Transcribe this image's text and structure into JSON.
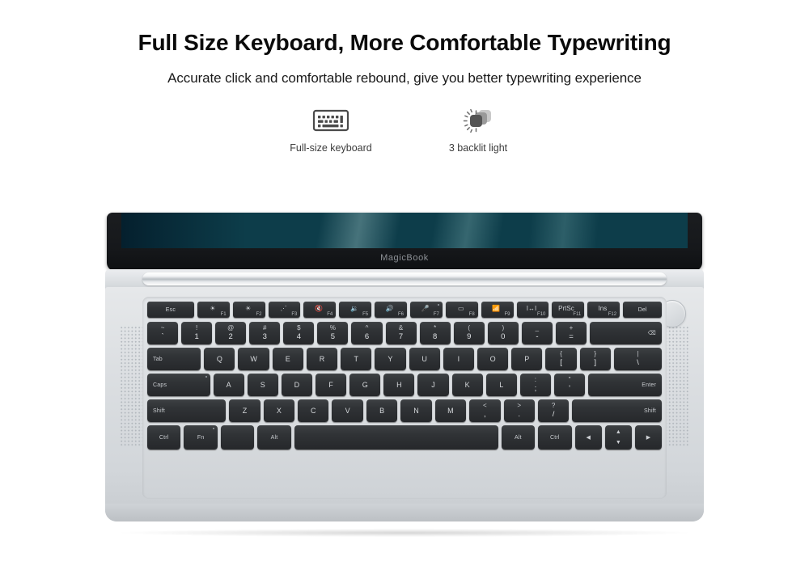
{
  "header": {
    "headline": "Full Size Keyboard, More Comfortable Typewriting",
    "subhead": "Accurate click and comfortable rebound, give you better typewriting experience"
  },
  "features": [
    {
      "icon": "keyboard-icon",
      "label": "Full-size keyboard"
    },
    {
      "icon": "backlight-icon",
      "label": "3 backlit light"
    }
  ],
  "laptop": {
    "brand": "MagicBook",
    "colors": {
      "body": "#d9dcdf",
      "key": "#303336",
      "screen_accent": "#2fae9d",
      "legend": "#d6d9dc"
    }
  },
  "keyboard": {
    "function_row": [
      {
        "label": "Esc",
        "glyph": "",
        "fn": "",
        "width": "w-esc",
        "center": true
      },
      {
        "label": "",
        "glyph": "☀",
        "fn": "F1"
      },
      {
        "label": "",
        "glyph": "☀",
        "fn": "F2"
      },
      {
        "label": "",
        "glyph": "⋰",
        "fn": "F3"
      },
      {
        "label": "",
        "glyph": "🔇",
        "fn": "F4"
      },
      {
        "label": "",
        "glyph": "🔉",
        "fn": "F5"
      },
      {
        "label": "",
        "glyph": "🔊",
        "fn": "F6"
      },
      {
        "label": "",
        "glyph": "🎤",
        "fn": "F7",
        "led": true
      },
      {
        "label": "",
        "glyph": "▭",
        "fn": "F8"
      },
      {
        "label": "",
        "glyph": "📶",
        "fn": "F9"
      },
      {
        "label": "",
        "glyph": "I↔I",
        "fn": "F10"
      },
      {
        "label": "PrtSc",
        "glyph": "",
        "fn": "F11"
      },
      {
        "label": "Ins",
        "glyph": "",
        "fn": "F12"
      },
      {
        "label": "Del",
        "glyph": "",
        "fn": "",
        "width": "w-del",
        "center": true
      }
    ],
    "number_row": [
      {
        "up": "~",
        "down": "`"
      },
      {
        "up": "!",
        "down": "1"
      },
      {
        "up": "@",
        "down": "2"
      },
      {
        "up": "#",
        "down": "3"
      },
      {
        "up": "$",
        "down": "4"
      },
      {
        "up": "%",
        "down": "5"
      },
      {
        "up": "^",
        "down": "6"
      },
      {
        "up": "&",
        "down": "7"
      },
      {
        "up": "*",
        "down": "8"
      },
      {
        "up": "(",
        "down": "9"
      },
      {
        "up": ")",
        "down": "0"
      },
      {
        "up": "_",
        "down": "-"
      },
      {
        "up": "+",
        "down": "="
      }
    ],
    "backspace_label": "⌫",
    "qwerty_row": {
      "tab_label": "Tab",
      "keys": [
        "Q",
        "W",
        "E",
        "R",
        "T",
        "Y",
        "U",
        "I",
        "O",
        "P"
      ],
      "bracket_left": {
        "up": "{",
        "down": "["
      },
      "bracket_right": {
        "up": "}",
        "down": "]"
      },
      "backslash": {
        "up": "|",
        "down": "\\"
      }
    },
    "home_row": {
      "caps_label": "Caps",
      "keys": [
        "A",
        "S",
        "D",
        "F",
        "G",
        "H",
        "J",
        "K",
        "L"
      ],
      "semicolon": {
        "up": ":",
        "down": ";"
      },
      "quote": {
        "up": "\"",
        "down": "'"
      },
      "enter_label": "Enter"
    },
    "shift_row": {
      "lshift_label": "Shift",
      "keys": [
        "Z",
        "X",
        "C",
        "V",
        "B",
        "N",
        "M"
      ],
      "comma": {
        "up": "<",
        "down": ","
      },
      "period": {
        "up": ">",
        "down": "."
      },
      "slash": {
        "up": "?",
        "down": "/"
      },
      "rshift_label": "Shift"
    },
    "bottom_row": {
      "ctrl_left": "Ctrl",
      "fn": "Fn",
      "win": "",
      "alt_left": "Alt",
      "space": "",
      "alt_right": "Alt",
      "ctrl_right": "Ctrl",
      "arrow_left": "◀",
      "arrow_up": "▲",
      "arrow_down": "▼",
      "arrow_right": "▶"
    }
  }
}
